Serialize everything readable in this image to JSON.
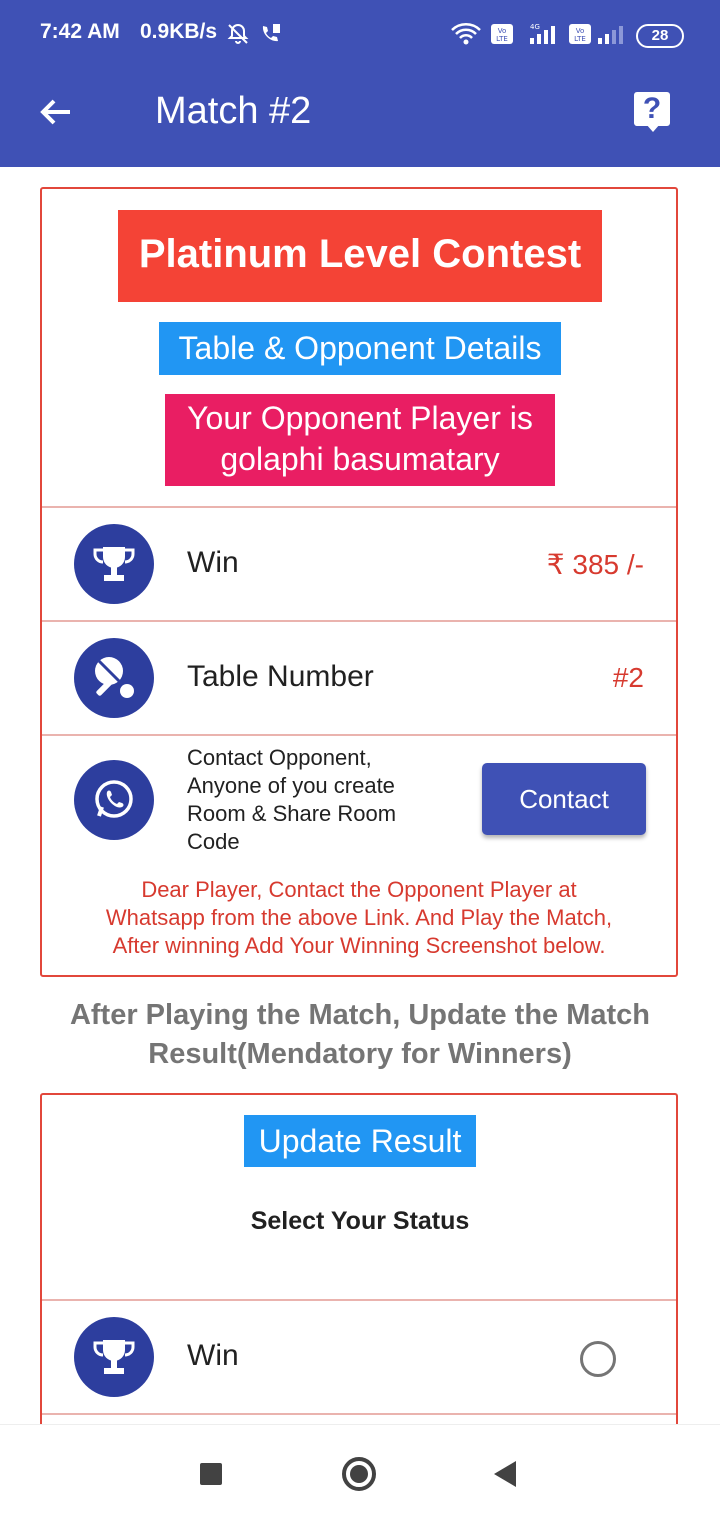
{
  "status_bar": {
    "time": "7:42 AM",
    "net_speed": "0.9KB/s",
    "battery": "28",
    "network_label": "4G",
    "volte_label": "Vo LTE"
  },
  "app_bar": {
    "title": "Match  #2",
    "help_label": "?"
  },
  "contest": {
    "level_title": "Platinum Level Contest",
    "details_heading": "Table & Opponent Details",
    "opponent_line1": "Your Opponent Player is",
    "opponent_line2": "golaphi basumatary"
  },
  "rows": {
    "win_label": "Win",
    "win_value": "₹ 385 /-",
    "table_label": "Table Number",
    "table_value": "#2",
    "contact_text_lines": [
      "Contact Opponent,",
      "Anyone of  you create",
      "Room & Share Room",
      "Code"
    ],
    "contact_button": "Contact",
    "note_lines": [
      "Dear Player, Contact the Opponent Player at",
      "Whatsapp from the above Link. And Play the Match,",
      "After winning Add Your Winning Screenshot below."
    ]
  },
  "after_match": {
    "line1": "After Playing the Match, Update the Match",
    "line2": "Result(Mendatory for Winners)"
  },
  "result_card": {
    "update_heading": "Update Result",
    "select_status": "Select Your Status",
    "win_option": "Win"
  },
  "colors": {
    "primary": "#3f51b5",
    "red": "#f44336",
    "blue": "#2196f3",
    "pink": "#e91e63",
    "accent_text": "#d73a2f"
  }
}
